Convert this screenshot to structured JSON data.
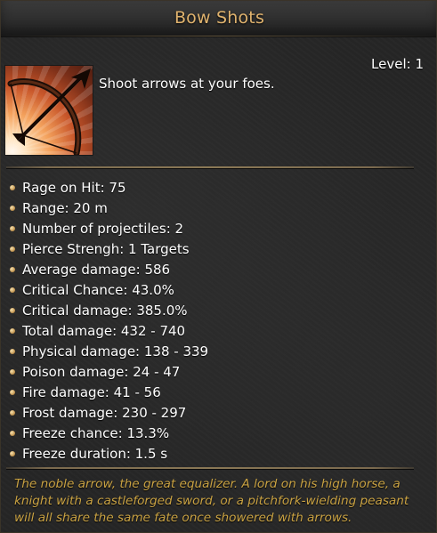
{
  "tooltip": {
    "title": "Bow Shots",
    "level": "Level: 1",
    "icon": "bow-and-arrow-icon",
    "description": "Shoot arrows at your foes.",
    "stats": [
      "Rage on Hit: 75",
      "Range: 20 m",
      "Number of projectiles: 2",
      "Pierce Strengh: 1 Targets",
      "Average damage: 586",
      "Critical Chance: 43.0%",
      "Critical damage: 385.0%",
      "Total damage: 432 - 740",
      "Physical damage: 138 - 339",
      "Poison damage: 24 - 47",
      "Fire damage: 41 - 56",
      "Frost damage: 230 - 297",
      "Freeze chance: 13.3%",
      "Freeze duration: 1.5 s"
    ],
    "flavor_lines": [
      "The noble arrow, the great equalizer. A lord on his high horse, a",
      "knight with a castleforged sword, or a pitchfork-wielding peasant",
      "will all share the same fate once showered with arrows."
    ]
  },
  "colors": {
    "title": "#e0b36e",
    "text": "#ffffff",
    "flavor": "#c9a243",
    "divider": "#8a7855",
    "background": "#262626"
  }
}
